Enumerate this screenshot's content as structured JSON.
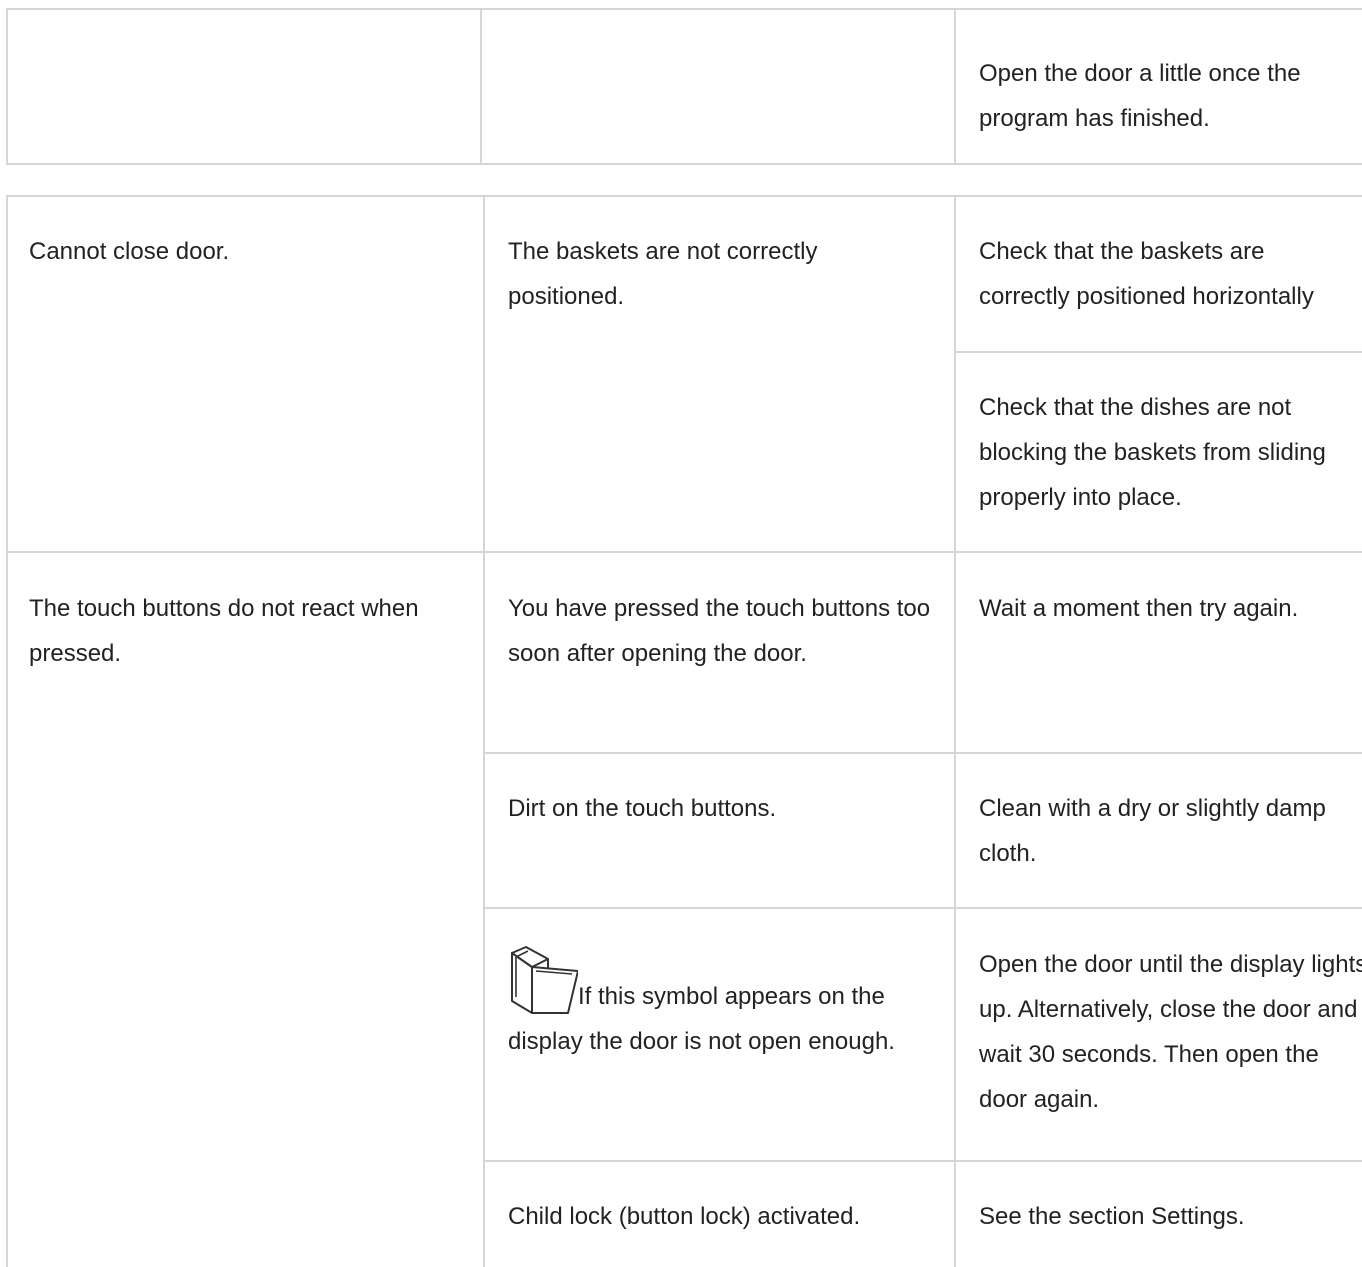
{
  "table_top": {
    "rows": [
      {
        "problem": "",
        "cause": "",
        "remedy": "Open the door a little once the program has finished."
      }
    ]
  },
  "table_main": {
    "rows": [
      {
        "problem": "Cannot close door.",
        "cause": "The baskets are not correctly positioned.",
        "remedies": [
          "Check that the baskets are correctly positioned horizontally",
          "Check that the dishes are not blocking the baskets from sliding properly into place."
        ]
      },
      {
        "problem": "The touch buttons do not react when pressed.",
        "causes": [
          {
            "cause": "You have pressed the touch buttons too soon after opening the door.",
            "remedy": "Wait a moment then try again."
          },
          {
            "cause": "Dirt on the touch buttons.",
            "remedy": "Clean with a dry or slightly damp cloth."
          },
          {
            "icon": "door-open-icon",
            "cause": "If this symbol appears on the display the door is not open enough.",
            "remedy": "Open the door until the display lights up. Alternatively, close the door and wait 30 seconds. Then open the door again."
          },
          {
            "cause": "Child lock (button lock) activated.",
            "remedy": "See the section Settings."
          }
        ]
      }
    ]
  }
}
